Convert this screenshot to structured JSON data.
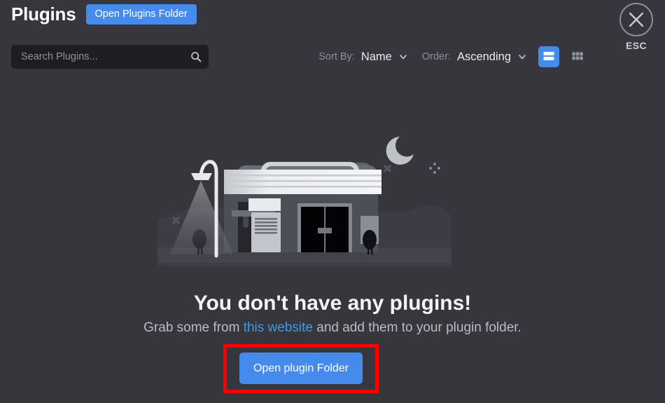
{
  "window": {
    "background": "#36363c",
    "accent": "#448bec",
    "highlight": "#ff0000"
  },
  "header": {
    "title": "Plugins",
    "open_folder_button": "Open Plugins Folder",
    "close": {
      "icon": "close-icon",
      "label": "ESC"
    }
  },
  "search": {
    "placeholder": "Search Plugins...",
    "value": "",
    "icon": "search-icon"
  },
  "toolbar": {
    "sort_by_label": "Sort By:",
    "sort_by_value": "Name",
    "sort_by_options": [
      "Name"
    ],
    "order_label": "Order:",
    "order_value": "Ascending",
    "order_options": [
      "Ascending"
    ],
    "chevron_icon": "chevron-down-icon",
    "views": [
      {
        "name": "list-view",
        "icon": "list-view-icon",
        "active": true
      },
      {
        "name": "grid-view",
        "icon": "grid-view-icon",
        "active": false
      }
    ]
  },
  "empty_state": {
    "illustration": "closed-store-night-illustration",
    "heading": "You don't have any plugins!",
    "sub_prefix": "Grab some from ",
    "sub_link": "this website",
    "sub_suffix": " and add them to your plugin folder.",
    "cta_label": "Open plugin Folder"
  }
}
